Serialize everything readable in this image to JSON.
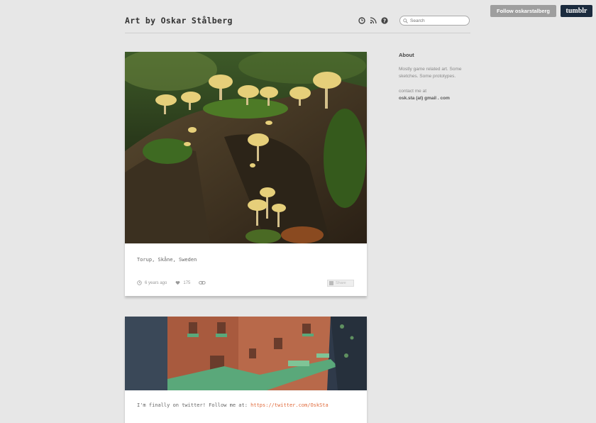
{
  "tumblr_controls": {
    "follow_label": "Follow oskarstalberg",
    "logo_text": "tumblr"
  },
  "header": {
    "title": "Art by Oskar Stålberg",
    "icons": [
      "archive-clock-icon",
      "rss-icon",
      "question-icon"
    ],
    "search_placeholder": "Search"
  },
  "sidebar": {
    "heading": "About",
    "description": "Mostly game related art. Some sketches. Some prototypes.",
    "contact_label": "contact me at",
    "email": "osk.sta (at) gmail . com"
  },
  "posts": [
    {
      "caption": "Torup, Skåne, Sweden",
      "time_ago": "6 years ago",
      "notes": "175",
      "share_label": "Share"
    },
    {
      "caption_text": "I'm finally on twitter! Follow me at: ",
      "caption_link": "https://twitter.com/OskSta"
    }
  ],
  "colors": {
    "background": "#e7e7e7",
    "link": "#e06a3b",
    "tumblr_brand": "#1b2b3e"
  }
}
